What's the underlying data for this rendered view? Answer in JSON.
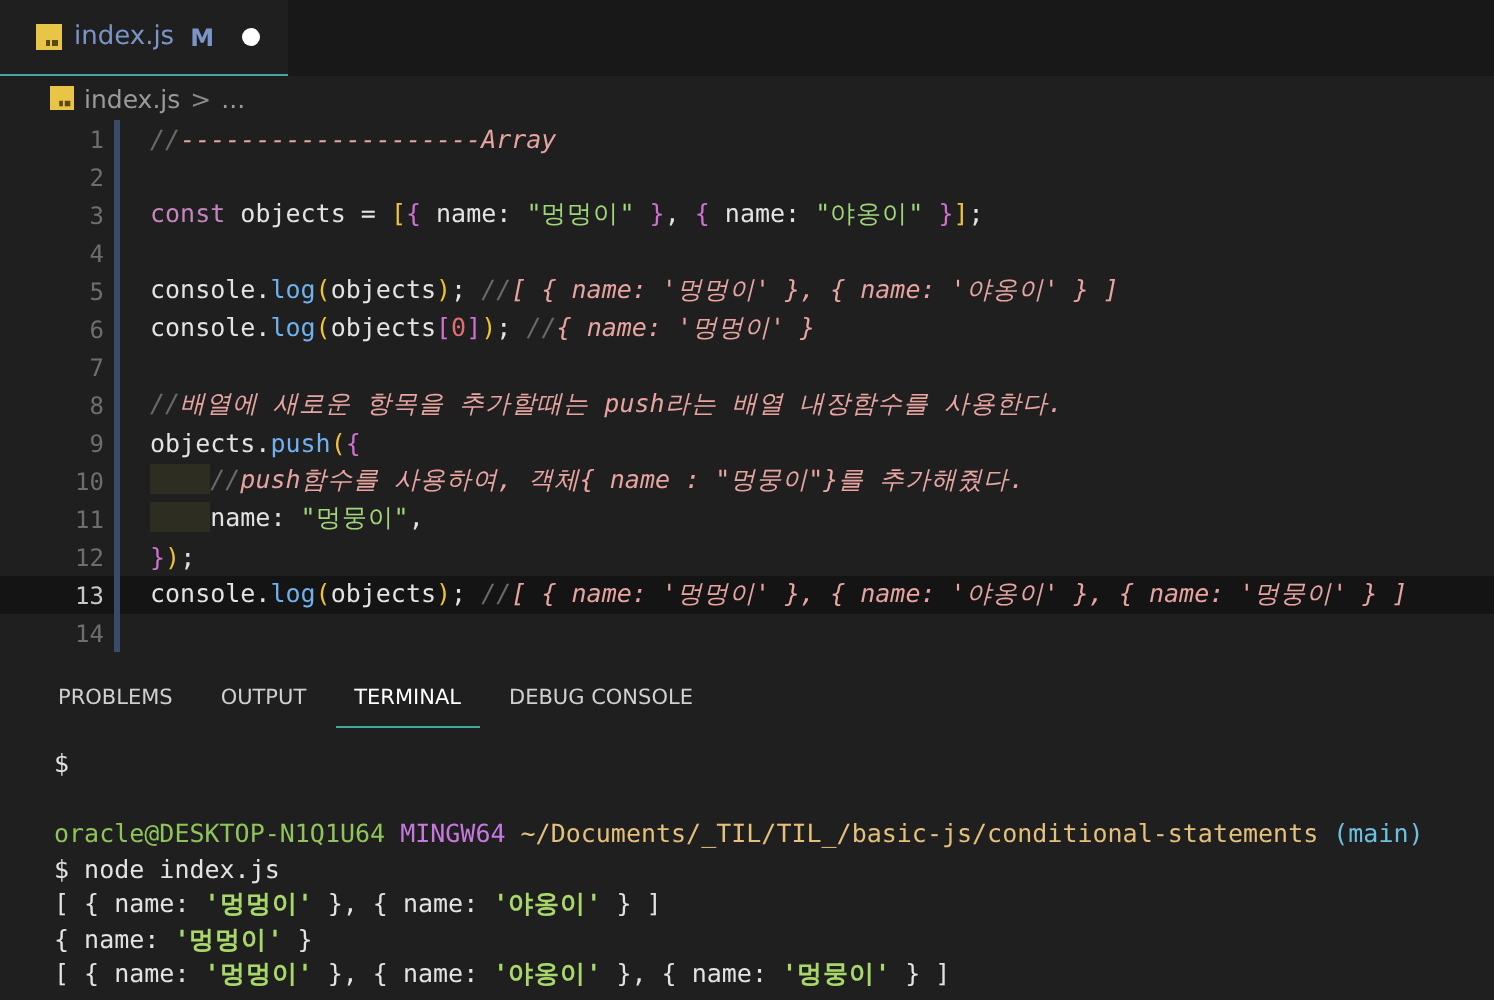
{
  "tabs": [
    {
      "label": "index.js",
      "badge": "M",
      "modified": true,
      "selected": true
    }
  ],
  "breadcrumb": {
    "file": "index.js",
    "separator": ">",
    "rest": "..."
  },
  "editor": {
    "lines": [
      {
        "n": "1",
        "current": false,
        "text": "//--------------------Array"
      },
      {
        "n": "2",
        "current": false
      },
      {
        "n": "3",
        "current": false,
        "text": "const objects = [{ name: \"멍멍이\" }, { name: \"야옹이\" }];"
      },
      {
        "n": "4",
        "current": false
      },
      {
        "n": "5",
        "current": false,
        "text": "console.log(objects); //[ { name: '멍멍이' }, { name: '야옹이' } ]"
      },
      {
        "n": "6",
        "current": false,
        "text": "console.log(objects[0]); //{ name: '멍멍이' }"
      },
      {
        "n": "7",
        "current": false
      },
      {
        "n": "8",
        "current": false,
        "text": "//배열에 새로운 항목을 추가할때는 push라는 배열 내장함수를 사용한다."
      },
      {
        "n": "9",
        "current": false,
        "text": "objects.push({"
      },
      {
        "n": "10",
        "current": false,
        "text": "    //push함수를 사용하여, 객체{ name : \"멍뭉이\"}를 추가해줬다."
      },
      {
        "n": "11",
        "current": false,
        "text": "    name: \"멍뭉이\","
      },
      {
        "n": "12",
        "current": false,
        "text": "});"
      },
      {
        "n": "13",
        "current": true,
        "text": "console.log(objects); //[ { name: '멍멍이' }, { name: '야옹이' }, { name: '멍뭉이' } ]"
      },
      {
        "n": "14",
        "current": false
      }
    ]
  },
  "panel_tabs": [
    {
      "label": "PROBLEMS",
      "selected": false
    },
    {
      "label": "OUTPUT",
      "selected": false
    },
    {
      "label": "TERMINAL",
      "selected": true
    },
    {
      "label": "DEBUG CONSOLE",
      "selected": false
    }
  ],
  "terminal": [
    {
      "kind": "output",
      "text": "$"
    },
    {
      "kind": "prompt",
      "user": "oracle@DESKTOP-N1Q1U64",
      "host": "MINGW64",
      "path": "~/Documents/_TIL/TIL_/basic-js/conditional-statements",
      "branch": "(main)"
    },
    {
      "kind": "output",
      "text": "$ node index.js"
    },
    {
      "kind": "output",
      "text": "[ { name: '멍멍이' }, { name: '야옹이' } ]"
    },
    {
      "kind": "output",
      "text": "{ name: '멍멍이' }"
    },
    {
      "kind": "output",
      "text": "[ { name: '멍멍이' }, { name: '야옹이' }, { name: '멍뭉이' } ]"
    }
  ]
}
